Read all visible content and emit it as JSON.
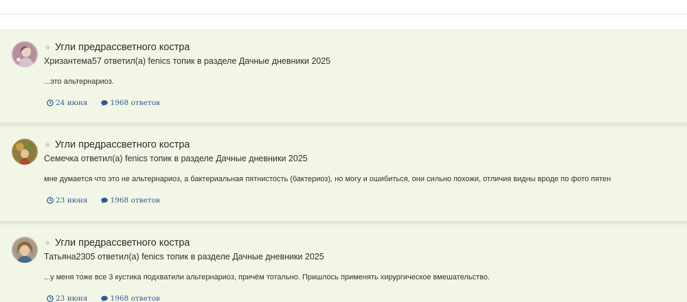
{
  "colors": {
    "card_bg": "#f2f6e6",
    "divider": "#e4e9d6",
    "link": "#2f5a92",
    "star": "#cfd3c4",
    "text": "#2e2e2e"
  },
  "icons": {
    "star": "star-icon",
    "date": "clock-icon",
    "replies": "comment-icon"
  },
  "activities": [
    {
      "star": "★",
      "title": "Угли предрассветного костра",
      "meta": "Хризантема57 ответил(а) fenics топик в разделе Дачные дневники 2025",
      "snippet": "...это альтернариоз.",
      "date": "24 июня",
      "replies": "1968 ответов"
    },
    {
      "star": "★",
      "title": "Угли предрассветного костра",
      "meta": "Семечка ответил(а) fenics топик в разделе Дачные дневники 2025",
      "snippet": "мне думается что это не альтернариоз, а бактериальная пятнистость (бактериоз), но могу и ошибиться, они сильно похожи, отличия видны вроде по фото пятен",
      "date": "23 июня",
      "replies": "1968 ответов"
    },
    {
      "star": "★",
      "title": "Угли предрассветного костра",
      "meta": "Татьяна2305 ответил(а) fenics топик в разделе Дачные дневники 2025",
      "snippet": "...у меня тоже все 3 кустика подхватили альтернариоз, причём тотально. Пришлось применять хирургическое вмешательство.",
      "date": "23 июня",
      "replies": "1968 ответов"
    }
  ]
}
